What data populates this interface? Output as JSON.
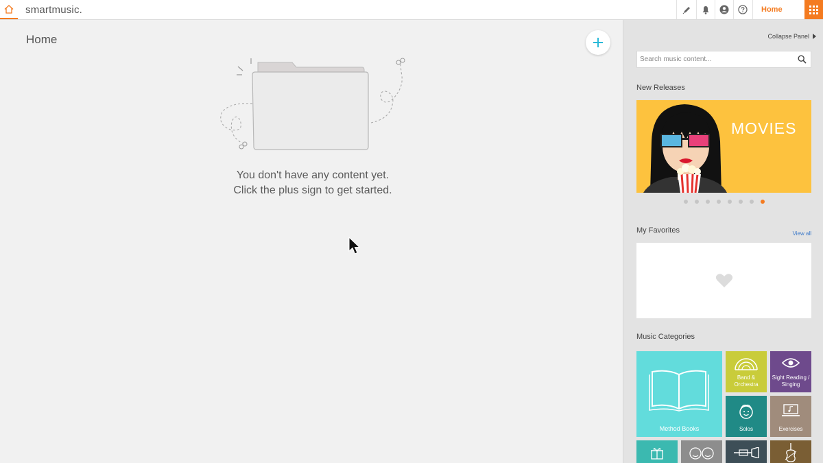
{
  "topbar": {
    "brand": "smartmusic.",
    "icons": [
      "home-icon",
      "pen-icon",
      "bell-icon",
      "user-icon",
      "help-icon",
      "apps-grid-icon"
    ],
    "active_tab": "Home"
  },
  "main": {
    "title": "Home",
    "empty_line1": "You don't have any content yet.",
    "empty_line2": "Click the plus sign to get started."
  },
  "panel": {
    "collapse_label": "Collapse Panel",
    "search_placeholder": "Search music content...",
    "new_releases_title": "New Releases",
    "release_label": "MOVIES",
    "carousel": {
      "count": 8,
      "active_index": 7
    },
    "favorites_title": "My Favorites",
    "view_all": "View all",
    "categories_title": "Music Categories",
    "categories": {
      "method_books": "Method Books",
      "band": "Band & Orchestra",
      "sight_reading": "Sight Reading / Singing",
      "solos": "Solos",
      "exercises": "Exercises"
    }
  },
  "colors": {
    "accent": "#f47b20",
    "plus": "#29b9d8",
    "release_bg": "#fdc23e",
    "method_books": "#62dcdc",
    "band": "#c9cc3a",
    "sight_reading": "#6e4a8c",
    "solos": "#208a86",
    "exercises": "#a08c7c"
  }
}
